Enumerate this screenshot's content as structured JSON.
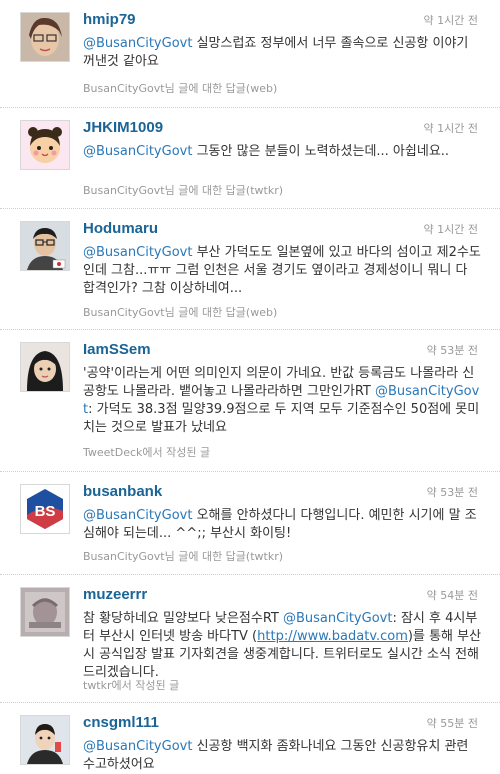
{
  "tweets": [
    {
      "user": "hmip79",
      "time": "약 1시간 전",
      "mention": "@BusanCityGovt",
      "text": " 실망스럽죠 정부에서 너무 졸속으로 신공항 이야기 꺼낸것 같아요",
      "source": "BusanCityGovt님 글에 대한 답글(web)"
    },
    {
      "user": "JHKIM1009",
      "time": "약 1시간 전",
      "mention": "@BusanCityGovt",
      "text": " 그동안 많은 분들이 노력하셨는데... 아쉽네요..",
      "source": "BusanCityGovt님 글에 대한 답글(twtkr)"
    },
    {
      "user": "Hodumaru",
      "time": "약 1시간 전",
      "mention": "@BusanCityGovt",
      "text": " 부산 가덕도도 일본옆에 있고 바다의 섬이고 제2수도인데 그참...ㅠㅠ 그럼 인천은 서울 경기도 옆이라고 경제성이니 뭐니 다 합격인가? 그참 이상하네여...",
      "source": "BusanCityGovt님 글에 대한 답글(web)"
    },
    {
      "user": "IamSSem",
      "time": "약 53분 전",
      "text_before": "'공약'이라는게 어떤 의미인지 의문이 가네요. 반값 등록금도 나몰라라 신공항도 나몰라라. 뱉어놓고 나몰라라하면 그만인가RT ",
      "mention": "@BusanCityGovt",
      "text": ": 가덕도 38.3점 밀양39.9점으로 두 지역 모두 기준점수인 50점에 못미치는 것으로 발표가 났네요",
      "source": "TweetDeck에서 작성된 글"
    },
    {
      "user": "busanbank",
      "time": "약 53분 전",
      "mention": "@BusanCityGovt",
      "text": " 오해를 안하셨다니 다행입니다. 예민한 시기에 말 조심해야 되는데... ^^;; 부산시 화이팅!",
      "source": "BusanCityGovt님 글에 대한 답글(twtkr)",
      "logo_text": "BS"
    },
    {
      "user": "muzeerrr",
      "time": "약 54분 전",
      "text_before": "참 황당하네요 밀양보다 낮은점수RT ",
      "mention": "@BusanCityGovt",
      "text_middle": ": 잠시 후 4시부터 부산시 인터넷 방송 바다TV (",
      "link": "http://www.badatv.com",
      "text": ")를 통해 부산시 공식입장 발표 기자회견을 생중계합니다. 트위터로도 실시간 소식 전해드리겠습니다.",
      "source": "twtkr에서 작성된 글"
    },
    {
      "user": "cnsgml111",
      "time": "약 55분 전",
      "mention": "@BusanCityGovt",
      "text": " 신공항 백지화 좀화나네요 그동안 신공항유치 관련 수고하셨어요",
      "source": ""
    }
  ],
  "colors": {
    "username": "#1a6496",
    "mention": "#2a78b8",
    "meta": "#999999",
    "busanbank_brand": "#1f4fa0"
  }
}
